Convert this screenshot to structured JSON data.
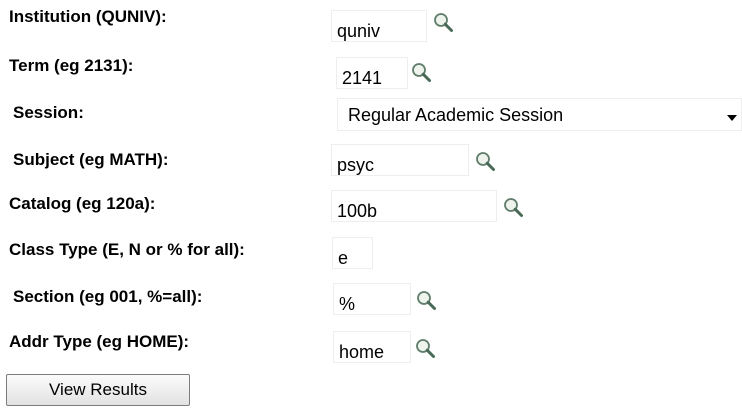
{
  "form": {
    "institution": {
      "label": "Institution (QUNIV):",
      "value": "quniv"
    },
    "term": {
      "label": "Term (eg 2131):",
      "value": "2141"
    },
    "session": {
      "label": "Session:",
      "value": "Regular Academic Session"
    },
    "subject": {
      "label": "Subject (eg MATH):",
      "value": "psyc"
    },
    "catalog": {
      "label": "Catalog (eg 120a):",
      "value": "100b"
    },
    "class_type": {
      "label": "Class Type (E, N or % for all):",
      "value": "e"
    },
    "section": {
      "label": "Section (eg 001, %=all):",
      "value": "%"
    },
    "addr_type": {
      "label": "Addr Type (eg HOME):",
      "value": "home"
    }
  },
  "icons": {
    "lookup": "magnifying-glass-icon",
    "dropdown": "caret-down-icon"
  },
  "actions": {
    "view_results_label": "View Results"
  }
}
